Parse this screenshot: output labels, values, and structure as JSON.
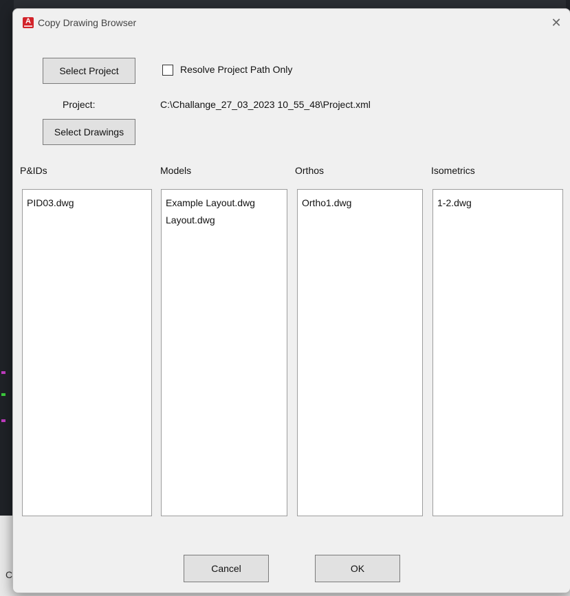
{
  "window": {
    "title": "Copy Drawing Browser",
    "close_glyph": "✕",
    "app_icon_letter": "A"
  },
  "top": {
    "select_project_label": "Select Project",
    "resolve_checkbox_label": "Resolve Project Path Only",
    "resolve_checked": false,
    "project_label": "Project:",
    "project_path": "C:\\Challange_27_03_2023 10_55_48\\Project.xml",
    "select_drawings_label": "Select Drawings"
  },
  "columns": [
    {
      "header": "P&IDs",
      "items": [
        "PID03.dwg"
      ]
    },
    {
      "header": "Models",
      "items": [
        "Example Layout.dwg",
        "Layout.dwg"
      ]
    },
    {
      "header": "Orthos",
      "items": [
        "Ortho1.dwg"
      ]
    },
    {
      "header": "Isometrics",
      "items": [
        "1-2.dwg"
      ]
    }
  ],
  "footer": {
    "cancel_label": "Cancel",
    "ok_label": "OK"
  },
  "background": {
    "bottom_left_letter": "C"
  },
  "colors": {
    "dialog_bg": "#f0f0f0",
    "button_bg": "#e1e1e1",
    "app_icon": "#d2232a"
  }
}
